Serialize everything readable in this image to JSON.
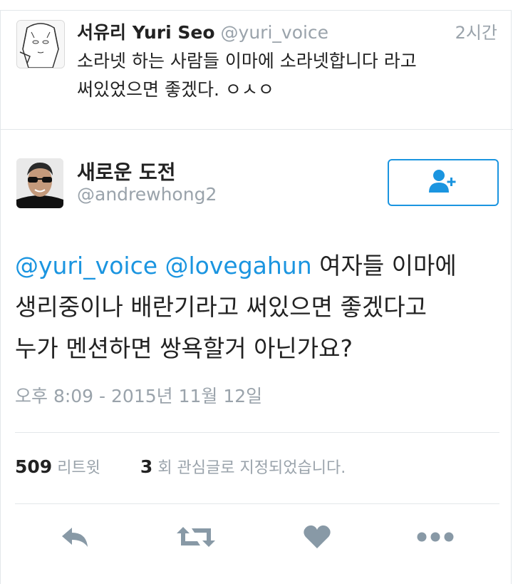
{
  "parent_tweet": {
    "display_name": "서유리 Yuri Seo",
    "handle": "@yuri_voice",
    "time": "2시간",
    "text_line1": "소라넷 하는 사람들 이마에 소라넷합니다 라고",
    "text_line2": "써있었으면 좋겠다. ㅇㅅㅇ"
  },
  "main_tweet": {
    "display_name": "새로운 도전",
    "handle": "@andrewhong2",
    "mention1": "@yuri_voice",
    "mention2": "@lovegahun",
    "text_line1_rest": " 여자들 이마에",
    "text_line2": "생리중이나 배란기라고 써있으면 좋겠다고",
    "text_line3": "누가 멘션하면 쌍욕할거 아닌가요?",
    "timestamp": "오후 8:09 - 2015년 11월 12일"
  },
  "stats": {
    "retweets_count": "509",
    "retweets_label": "리트윗",
    "likes_count": "3",
    "likes_label": "회 관심글로 지정되었습니다."
  },
  "colors": {
    "accent": "#1b95e0",
    "muted": "#9aa3ab",
    "icon": "#8899a6"
  },
  "icons": {
    "follow": "add-user-icon",
    "reply": "reply-icon",
    "retweet": "retweet-icon",
    "like": "heart-icon",
    "more": "more-icon"
  }
}
